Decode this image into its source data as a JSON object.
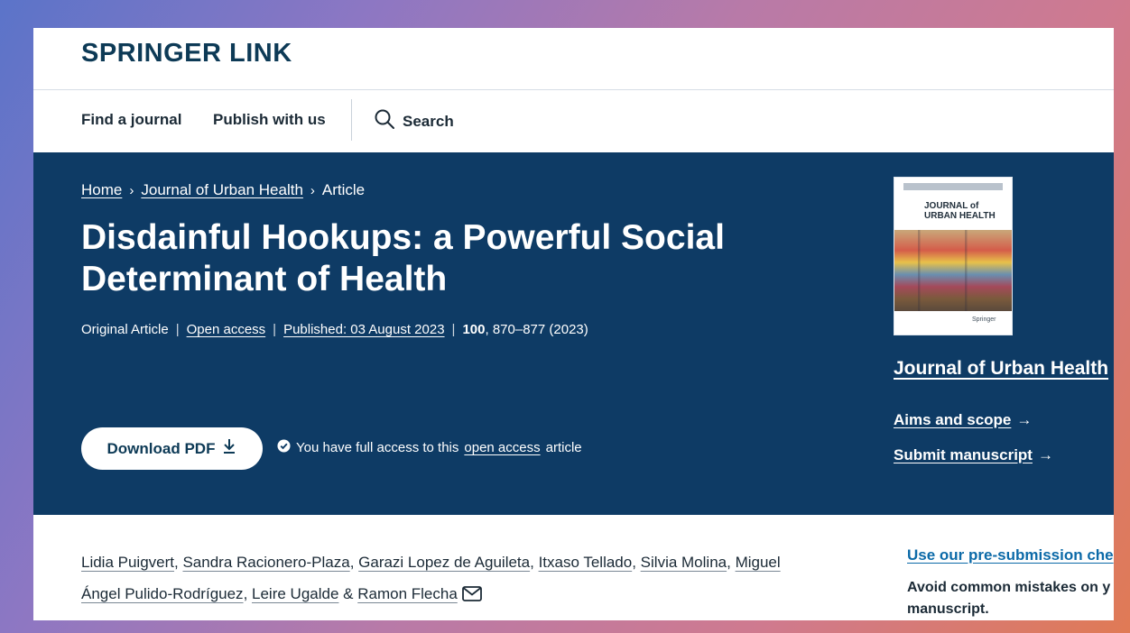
{
  "brand": {
    "logo": "SPRINGER LINK"
  },
  "nav": {
    "find_journal": "Find a journal",
    "publish": "Publish with us",
    "search": "Search"
  },
  "breadcrumb": {
    "home": "Home",
    "journal": "Journal of Urban Health",
    "current": "Article"
  },
  "article": {
    "title": "Disdainful Hookups: a Powerful Social Determinant of Health",
    "type": "Original Article",
    "access": "Open access",
    "published": "Published: 03 August 2023",
    "volume": "100",
    "pages_year": ", 870–877 (2023)"
  },
  "actions": {
    "download": "Download PDF",
    "access_prefix": "You have full access to this",
    "access_link": "open access",
    "access_suffix": "article"
  },
  "sidebar": {
    "journal_title": "Journal of Urban Health",
    "aims": "Aims and scope",
    "submit": "Submit manuscript",
    "cover_title_line1": "JOURNAL of",
    "cover_title_line2": "URBAN HEALTH",
    "cover_publisher": "Springer"
  },
  "authors": [
    "Lidia Puigvert",
    "Sandra Racionero-Plaza",
    "Garazi Lopez de Aguileta",
    "Itxaso Tellado",
    "Silvia Molina",
    "Miguel Ángel Pulido-Rodríguez",
    "Leire Ugalde",
    "Ramon Flecha"
  ],
  "presubmission": {
    "link": "Use our pre-submission che",
    "text": "Avoid common mistakes on y manuscript."
  },
  "colors": {
    "hero_bg": "#0e3b65",
    "brand": "#0d3a56",
    "link_blue": "#0c6aa8"
  }
}
